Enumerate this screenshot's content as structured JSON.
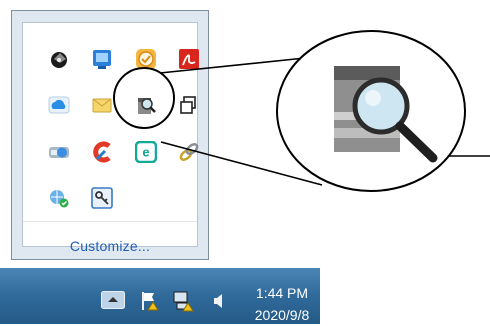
{
  "tray_popup": {
    "customize_label": "Customize...",
    "icons": [
      {
        "name": "speaker-app-icon"
      },
      {
        "name": "monitor-app-icon"
      },
      {
        "name": "clock-app-icon"
      },
      {
        "name": "pdf-app-icon"
      },
      {
        "name": "cloud-icon"
      },
      {
        "name": "mail-icon"
      },
      {
        "name": "scanner-icon"
      },
      {
        "name": "window-copy-icon"
      },
      {
        "name": "drive-icon"
      },
      {
        "name": "ccleaner-icon"
      },
      {
        "name": "eset-icon"
      },
      {
        "name": "link-icon"
      },
      {
        "name": "network-icon"
      },
      {
        "name": "key-icon"
      }
    ]
  },
  "taskbar": {
    "time": "1:44 PM",
    "date": "2020/9/8",
    "icons": [
      "show-hidden-icons-icon",
      "action-center-flag-icon",
      "network-icon",
      "volume-icon"
    ]
  },
  "zoom_callout": {
    "icon": "scanner-magnifier-icon"
  }
}
